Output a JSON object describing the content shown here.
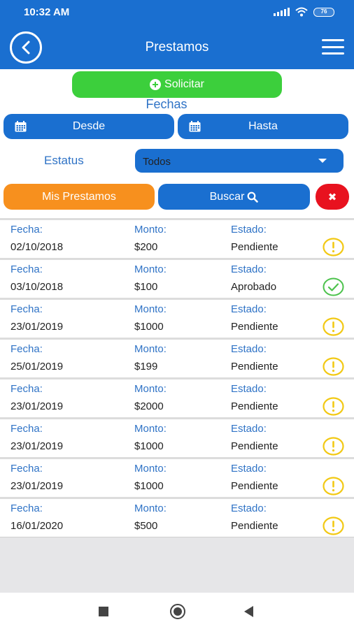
{
  "status_bar": {
    "time": "10:32 AM",
    "battery": "76"
  },
  "header": {
    "title": "Prestamos"
  },
  "actions": {
    "solicitar_label": "Solicitar"
  },
  "filters": {
    "fechas_label": "Fechas",
    "desde_label": "Desde",
    "hasta_label": "Hasta",
    "estatus_label": "Estatus",
    "estatus_value": "Todos"
  },
  "buttons": {
    "mis_prestamos": "Mis Prestamos",
    "buscar": "Buscar",
    "clear": "✖"
  },
  "column_labels": {
    "fecha": "Fecha:",
    "monto": "Monto:",
    "estado": "Estado:"
  },
  "loans": [
    {
      "fecha": "02/10/2018",
      "monto": "$200",
      "estado": "Pendiente",
      "icon": "warning-icon"
    },
    {
      "fecha": "03/10/2018",
      "monto": "$100",
      "estado": "Aprobado",
      "icon": "check-icon"
    },
    {
      "fecha": "23/01/2019",
      "monto": "$1000",
      "estado": "Pendiente",
      "icon": "warning-icon"
    },
    {
      "fecha": "25/01/2019",
      "monto": "$199",
      "estado": "Pendiente",
      "icon": "warning-icon"
    },
    {
      "fecha": "23/01/2019",
      "monto": "$2000",
      "estado": "Pendiente",
      "icon": "warning-icon"
    },
    {
      "fecha": "23/01/2019",
      "monto": "$1000",
      "estado": "Pendiente",
      "icon": "warning-icon"
    },
    {
      "fecha": "23/01/2019",
      "monto": "$1000",
      "estado": "Pendiente",
      "icon": "warning-icon"
    },
    {
      "fecha": "16/01/2020",
      "monto": "$500",
      "estado": "Pendiente",
      "icon": "warning-icon"
    }
  ],
  "colors": {
    "primary": "#1a6fd0",
    "success": "#3ccf3c",
    "orange": "#f7901e",
    "danger": "#e8121f",
    "warning_icon": "#f2c914",
    "check_icon": "#4cc24c",
    "label_text": "#2f73c6"
  }
}
